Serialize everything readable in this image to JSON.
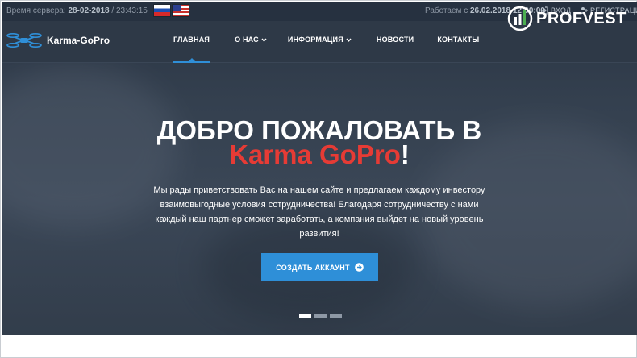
{
  "topbar": {
    "server_time_label": "Время сервера:",
    "server_date": "28-02-2018",
    "server_clock": "23:43:15",
    "work_since_label": "Работаем с",
    "work_since_value": "26.02.2018 12:00:00",
    "login_label": "ВХОД",
    "register_label": "РЕГИСТРАЦИЯ"
  },
  "logo": {
    "text": "Karma-GoPro"
  },
  "nav": {
    "items": [
      {
        "label": "ГЛАВНАЯ",
        "active": true,
        "dropdown": false
      },
      {
        "label": "О НАС",
        "dropdown": true
      },
      {
        "label": "ИНФОРМАЦИЯ",
        "dropdown": true
      },
      {
        "label": "НОВОСТИ",
        "dropdown": false
      },
      {
        "label": "КОНТАКТЫ",
        "dropdown": false
      }
    ]
  },
  "watermark": {
    "text": "PROFVEST"
  },
  "hero": {
    "title_line1": "ДОБРО ПОЖАЛОВАТЬ В",
    "title_accent": "Karma GoPro",
    "title_suffix": "!",
    "text": "Мы рады приветствовать Вас на нашем сайте и предлагаем каждому инвестору взаимовыгодные условия сотрудничества! Благодаря сотрудничеству с нами каждый наш партнер сможет заработать, а компания выйдет на новый уровень развития!",
    "cta_label": "СОЗДАТЬ АККАУНТ"
  },
  "slider": {
    "total": 3,
    "active_index": 0
  },
  "colors": {
    "accent_red": "#e63b35",
    "button_blue": "#2e8fd8",
    "bg_dark": "#2e3947"
  }
}
